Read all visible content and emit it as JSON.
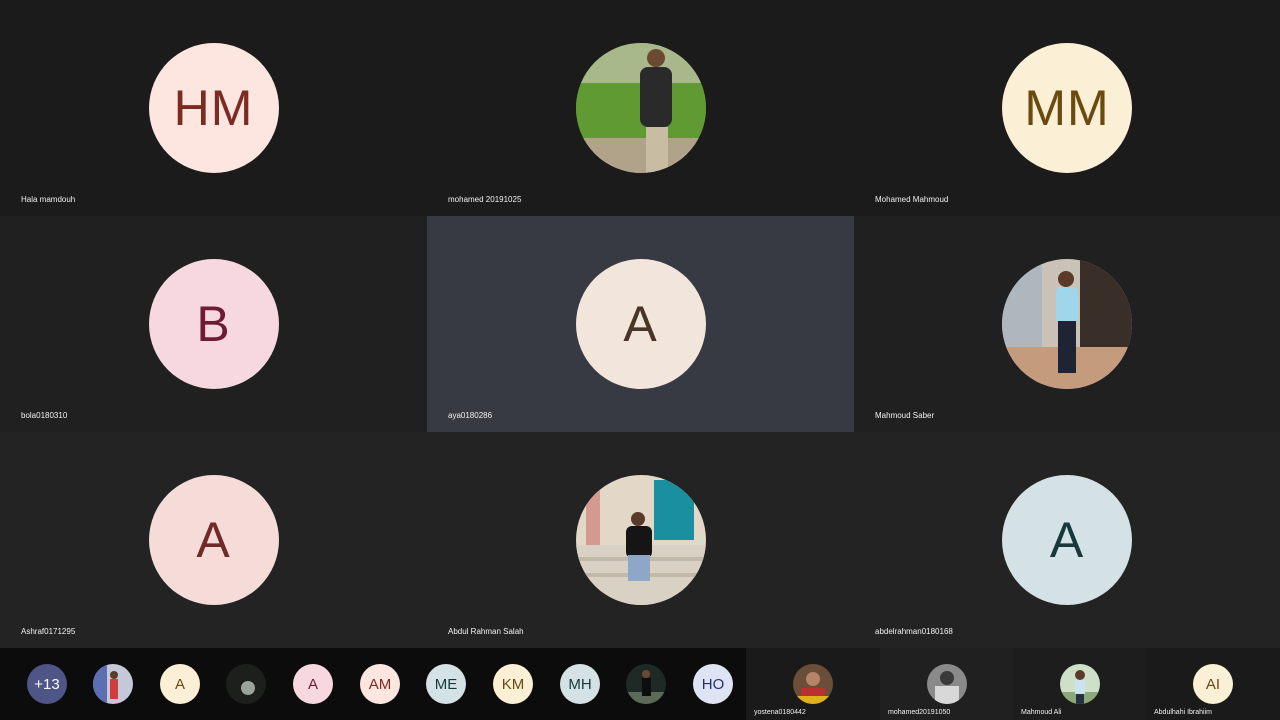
{
  "tiles": [
    {
      "name": "Hala mamdouh",
      "initials": "HM",
      "bg": "#fde5e0",
      "fg": "#7a2b22",
      "type": "initials"
    },
    {
      "name": "mohamed 20191025",
      "initials": "",
      "type": "photo",
      "photo": "person-outdoor-icon"
    },
    {
      "name": "Mohamed Mahmoud",
      "initials": "MM",
      "bg": "#fbf0d6",
      "fg": "#6b4a0f",
      "type": "initials"
    },
    {
      "name": "bola0180310",
      "initials": "B",
      "bg": "#f7d8e1",
      "fg": "#6e1c33",
      "type": "initials"
    },
    {
      "name": "aya0180286",
      "initials": "A",
      "bg": "#f2e5dc",
      "fg": "#4a3427",
      "type": "initials",
      "speaking": true
    },
    {
      "name": "Mahmoud Saber",
      "initials": "",
      "type": "photo",
      "photo": "person-standing-icon"
    },
    {
      "name": "Ashraf0171295",
      "initials": "A",
      "bg": "#f6dcd8",
      "fg": "#702a28",
      "type": "initials"
    },
    {
      "name": "Abdul Rahman Salah",
      "initials": "",
      "type": "photo",
      "photo": "person-sitting-icon"
    },
    {
      "name": "abdelrahman0180168",
      "initials": "A",
      "bg": "#d4e1e5",
      "fg": "#17393c",
      "type": "initials"
    }
  ],
  "strip": {
    "thumbs": [
      {
        "label": "+13",
        "bg": "#4f5587",
        "fg": "#ffffff",
        "type": "count"
      },
      {
        "label": "",
        "type": "photo",
        "photo": "person-photo-icon"
      },
      {
        "label": "A",
        "bg": "#fbf0d6",
        "fg": "#6b4a0f",
        "type": "initials"
      },
      {
        "label": "",
        "type": "photo",
        "photo": "dark-photo-icon"
      },
      {
        "label": "A",
        "bg": "#f7d8e1",
        "fg": "#6e1c33",
        "type": "initials"
      },
      {
        "label": "AM",
        "bg": "#fde5e0",
        "fg": "#7a2b22",
        "type": "initials"
      },
      {
        "label": "ME",
        "bg": "#d4e1e5",
        "fg": "#17393c",
        "type": "initials"
      },
      {
        "label": "KM",
        "bg": "#fbf0d6",
        "fg": "#6b4a0f",
        "type": "initials"
      },
      {
        "label": "MH",
        "bg": "#d4e1e5",
        "fg": "#17393c",
        "type": "initials"
      },
      {
        "label": "",
        "type": "photo",
        "photo": "night-photo-icon"
      },
      {
        "label": "HO",
        "bg": "#dfe4f5",
        "fg": "#25306a",
        "type": "initials"
      }
    ],
    "mini": [
      {
        "name": "yostena0180442",
        "type": "photo",
        "photo": "portrait-photo-icon"
      },
      {
        "name": "mohamed20191050",
        "type": "photo",
        "photo": "bw-photo-icon"
      },
      {
        "name": "Mahmoud Ali",
        "type": "photo",
        "photo": "outdoor-photo-icon"
      },
      {
        "name": "Abdulhahi Ibrahiim",
        "initials": "AI",
        "bg": "#fbf0d6",
        "fg": "#6b4a0f",
        "type": "initials"
      }
    ]
  }
}
